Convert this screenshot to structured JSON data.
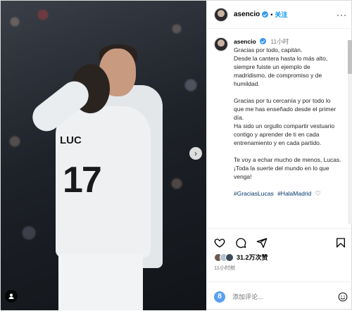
{
  "header": {
    "username": "asencio",
    "follow_label": "关注",
    "separator": "•",
    "more_label": "···"
  },
  "media": {
    "jersey_name": "LUC",
    "jersey_number": "17",
    "next_arrow": "›"
  },
  "caption": {
    "username": "asencio",
    "time": "11小时",
    "paragraphs": [
      "Gracias por todo, capitán.\nDesde la cantera hasta lo más alto, siempre fuiste un ejemplo de madridismo, de compromiso y de humildad.",
      "Gracias por tu cercanía y por todo lo que me has enseñado desde el primer día.\nHa sido un orgullo compartir vestuario contigo y aprender de ti en cada entrenamiento y en cada partido.",
      "Te voy a echar mucho de menos, Lucas. ¡Toda la suerte del mundo en lo que venga!"
    ],
    "hashtags": [
      "#GraciasLucas",
      "#HalaMadrid"
    ]
  },
  "actions": {
    "likes": "31.2万次赞",
    "post_time": "11小时前"
  },
  "comment": {
    "avatar_letter": "8",
    "placeholder": "添加评论..."
  },
  "colors": {
    "link": "#0095f6",
    "hashtag": "#00376b",
    "verified": "#3897f0",
    "muted": "#737373"
  },
  "icons": [
    "like-heart-icon",
    "comment-icon",
    "share-icon",
    "save-icon",
    "emoji-icon",
    "verified-badge-icon",
    "user-tag-icon",
    "next-arrow-icon"
  ]
}
